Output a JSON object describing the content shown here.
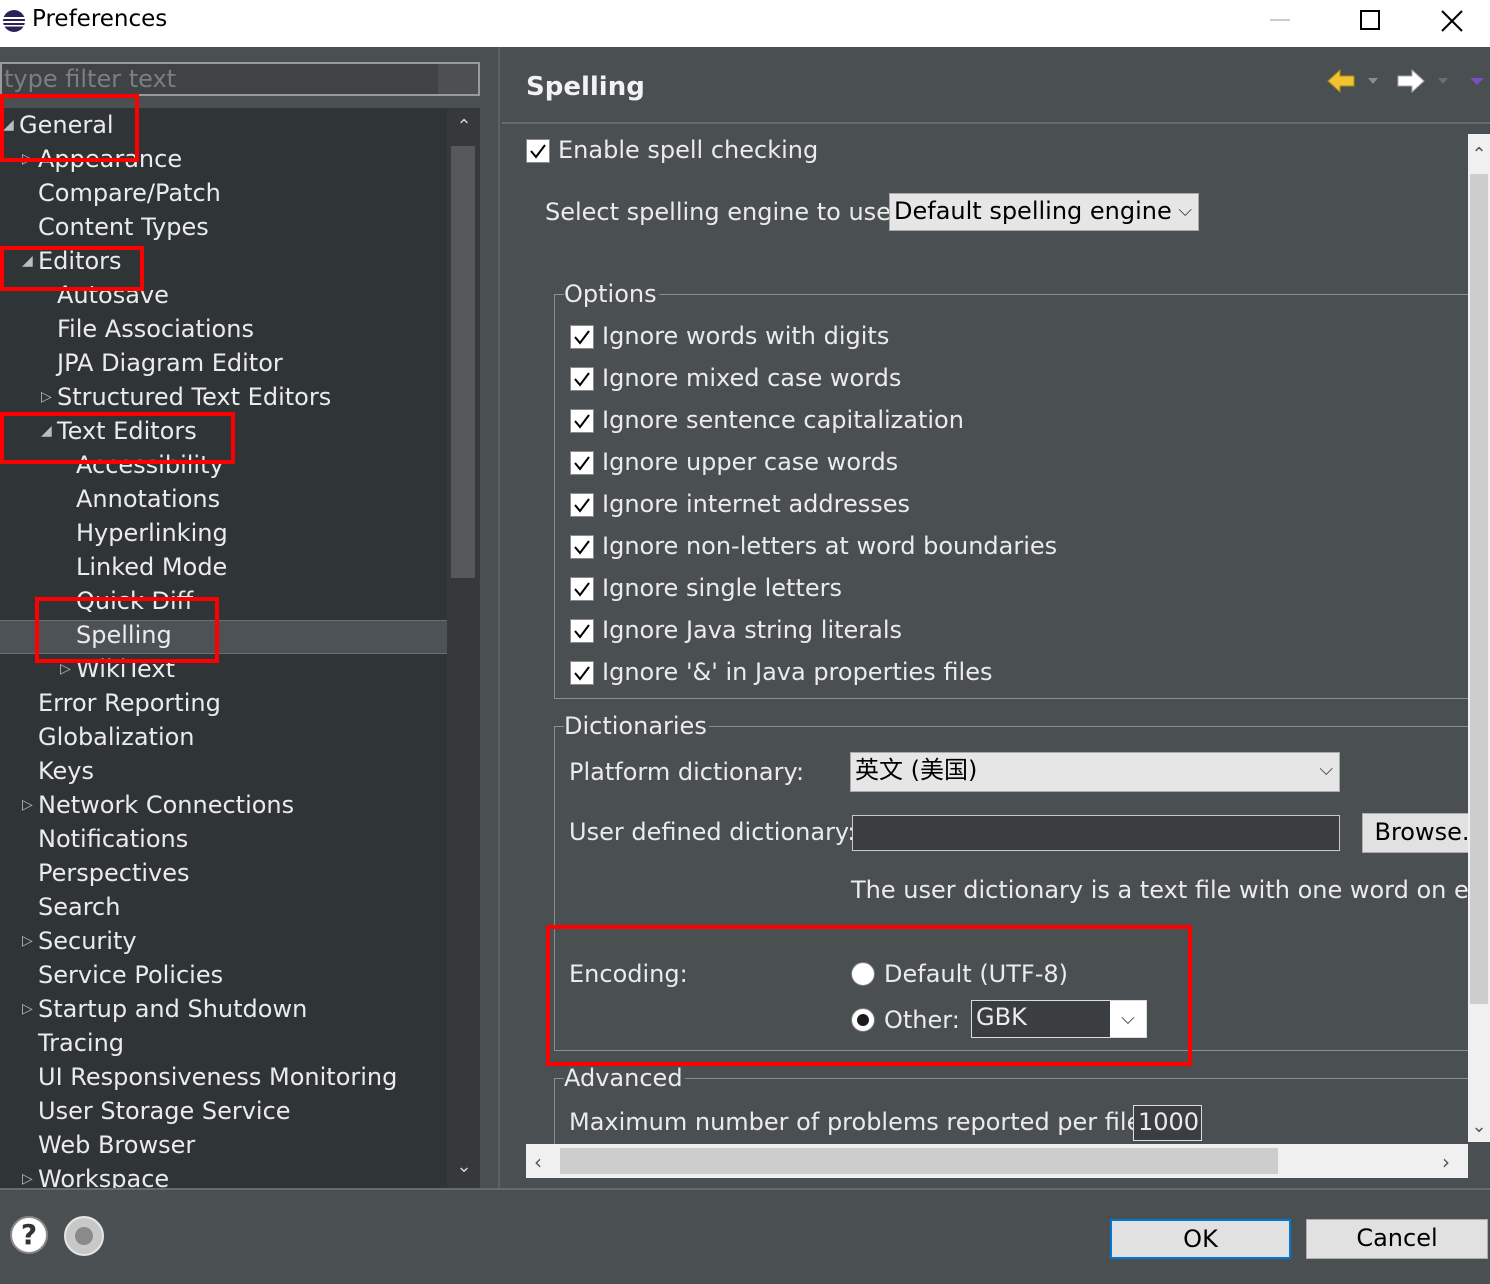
{
  "window": {
    "title": "Preferences"
  },
  "filter": {
    "placeholder": "type filter text"
  },
  "tree": [
    {
      "label": "General",
      "level": 0,
      "expander": "expanded"
    },
    {
      "label": "Appearance",
      "level": 1,
      "expander": "collapsed"
    },
    {
      "label": "Compare/Patch",
      "level": 1,
      "expander": "none"
    },
    {
      "label": "Content Types",
      "level": 1,
      "expander": "none"
    },
    {
      "label": "Editors",
      "level": 1,
      "expander": "expanded"
    },
    {
      "label": "Autosave",
      "level": 2,
      "expander": "none"
    },
    {
      "label": "File Associations",
      "level": 2,
      "expander": "none"
    },
    {
      "label": "JPA Diagram Editor",
      "level": 2,
      "expander": "none"
    },
    {
      "label": "Structured Text Editors",
      "level": 2,
      "expander": "collapsed"
    },
    {
      "label": "Text Editors",
      "level": 2,
      "expander": "expanded"
    },
    {
      "label": "Accessibility",
      "level": 3,
      "expander": "none"
    },
    {
      "label": "Annotations",
      "level": 3,
      "expander": "none"
    },
    {
      "label": "Hyperlinking",
      "level": 3,
      "expander": "none"
    },
    {
      "label": "Linked Mode",
      "level": 3,
      "expander": "none"
    },
    {
      "label": "Quick Diff",
      "level": 3,
      "expander": "none"
    },
    {
      "label": "Spelling",
      "level": 3,
      "expander": "none",
      "selected": true
    },
    {
      "label": "WikiText",
      "level": 3,
      "expander": "collapsed"
    },
    {
      "label": "Error Reporting",
      "level": 1,
      "expander": "none"
    },
    {
      "label": "Globalization",
      "level": 1,
      "expander": "none"
    },
    {
      "label": "Keys",
      "level": 1,
      "expander": "none"
    },
    {
      "label": "Network Connections",
      "level": 1,
      "expander": "collapsed"
    },
    {
      "label": "Notifications",
      "level": 1,
      "expander": "none"
    },
    {
      "label": "Perspectives",
      "level": 1,
      "expander": "none"
    },
    {
      "label": "Search",
      "level": 1,
      "expander": "none"
    },
    {
      "label": "Security",
      "level": 1,
      "expander": "collapsed"
    },
    {
      "label": "Service Policies",
      "level": 1,
      "expander": "none"
    },
    {
      "label": "Startup and Shutdown",
      "level": 1,
      "expander": "collapsed"
    },
    {
      "label": "Tracing",
      "level": 1,
      "expander": "none"
    },
    {
      "label": "UI Responsiveness Monitoring",
      "level": 1,
      "expander": "none"
    },
    {
      "label": "User Storage Service",
      "level": 1,
      "expander": "none"
    },
    {
      "label": "Web Browser",
      "level": 1,
      "expander": "none"
    },
    {
      "label": "Workspace",
      "level": 1,
      "expander": "collapsed"
    }
  ],
  "page": {
    "title": "Spelling",
    "enable_label": "Enable spell checking",
    "engine_label": "Select spelling engine to use:",
    "engine_value": "Default spelling engine",
    "options_title": "Options",
    "options": [
      "Ignore words with digits",
      "Ignore mixed case words",
      "Ignore sentence capitalization",
      "Ignore upper case words",
      "Ignore internet addresses",
      "Ignore non-letters at word boundaries",
      "Ignore single letters",
      "Ignore Java string literals",
      "Ignore '&' in Java properties files"
    ],
    "dictionaries_title": "Dictionaries",
    "platform_dict_label": "Platform dictionary:",
    "platform_dict_value": "英文 (美国)",
    "user_dict_label": "User defined dictionary:",
    "user_dict_value": "",
    "browse_label": "Browse.",
    "user_dict_hint": "The user dictionary is a text file with one word on each",
    "encoding_label": "Encoding:",
    "encoding_default_label": "Default (UTF-8)",
    "encoding_other_label": "Other:",
    "encoding_other_value": "GBK",
    "advanced_title": "Advanced",
    "max_problems_label": "Maximum number of problems reported per file:",
    "max_problems_value": "1000"
  },
  "buttons": {
    "ok": "OK",
    "cancel": "Cancel"
  },
  "icons": {
    "app": "eclipse-icon",
    "minimize": "minimize-icon",
    "maximize": "maximize-icon",
    "close": "close-icon",
    "back": "back-arrow-icon",
    "forward": "forward-arrow-icon",
    "menu": "view-menu-icon",
    "help": "help-icon",
    "settings": "settings-icon"
  },
  "colors": {
    "panel_bg": "#4a4f52",
    "tree_bg": "#2f3437",
    "annotation": "#ff0000",
    "nav_arrow": "#f1c232"
  }
}
